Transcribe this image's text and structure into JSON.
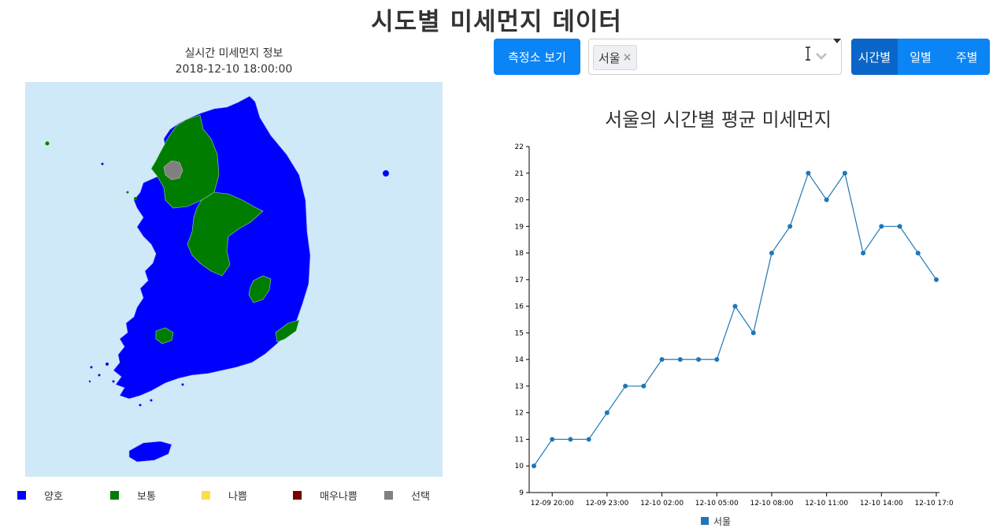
{
  "header": {
    "title": "시도별 미세먼지 데이터"
  },
  "map": {
    "caption": "실시간 미세먼지 정보",
    "datetime": "2018-12-10 18:00:00",
    "legend": [
      {
        "label": "양호",
        "color": "#0000ff"
      },
      {
        "label": "보통",
        "color": "#007d00"
      },
      {
        "label": "나쁨",
        "color": "#f6e04f"
      },
      {
        "label": "매우나쁨",
        "color": "#7a0000"
      },
      {
        "label": "선택",
        "color": "#808080"
      }
    ]
  },
  "toolbar": {
    "station_button": "측정소 보기",
    "selected_region": "서울",
    "remove_icon": "×",
    "tabs": [
      {
        "label": "시간별",
        "active": true
      },
      {
        "label": "일별",
        "active": false
      },
      {
        "label": "주별",
        "active": false
      }
    ]
  },
  "chart_data": {
    "type": "line",
    "title": "서울의 시간별 평균 미세먼지",
    "x": [
      "12-09 19:00",
      "12-09 20:00",
      "12-09 21:00",
      "12-09 22:00",
      "12-09 23:00",
      "12-10 00:00",
      "12-10 01:00",
      "12-10 02:00",
      "12-10 03:00",
      "12-10 04:00",
      "12-10 05:00",
      "12-10 06:00",
      "12-10 07:00",
      "12-10 08:00",
      "12-10 09:00",
      "12-10 10:00",
      "12-10 11:00",
      "12-10 12:00",
      "12-10 13:00",
      "12-10 14:00",
      "12-10 15:00",
      "12-10 16:00",
      "12-10 17:00"
    ],
    "x_tick_labels": [
      "12-09 20:00",
      "12-09 23:00",
      "12-10 02:00",
      "12-10 05:00",
      "12-10 08:00",
      "12-10 11:00",
      "12-10 14:00",
      "12-10 17:00"
    ],
    "series": [
      {
        "name": "서울",
        "color": "#2077b4",
        "values": [
          10,
          11,
          11,
          11,
          12,
          13,
          13,
          14,
          14,
          14,
          14,
          16,
          15,
          18,
          19,
          21,
          20,
          21,
          18,
          19,
          19,
          18,
          17
        ]
      }
    ],
    "ylim": [
      9,
      22
    ],
    "y_ticks": [
      9,
      10,
      11,
      12,
      13,
      14,
      15,
      16,
      17,
      18,
      19,
      20,
      21,
      22
    ],
    "legend_position": "bottom"
  }
}
